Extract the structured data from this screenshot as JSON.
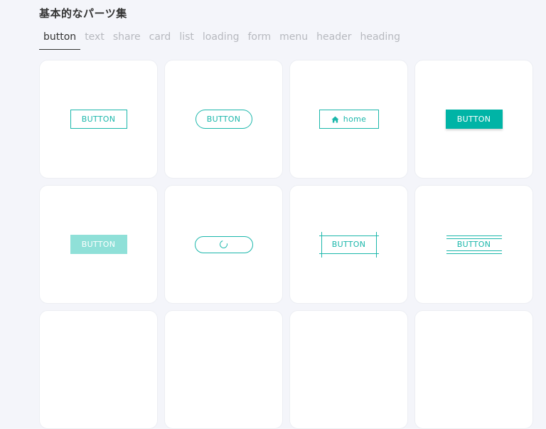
{
  "page": {
    "title": "基本的なパーツ集"
  },
  "tabs": [
    {
      "label": "button",
      "active": true
    },
    {
      "label": "text"
    },
    {
      "label": "share"
    },
    {
      "label": "card"
    },
    {
      "label": "list"
    },
    {
      "label": "loading"
    },
    {
      "label": "form"
    },
    {
      "label": "menu"
    },
    {
      "label": "header"
    },
    {
      "label": "heading"
    }
  ],
  "buttons": {
    "outline": "BUTTON",
    "pill": "BUTTON",
    "home": "home",
    "solid": "BUTTON",
    "soft": "BUTTON",
    "cross": "BUTTON",
    "lines": "BUTTON"
  },
  "icons": {
    "home": "home-icon",
    "loading": "spinner-icon"
  },
  "colors": {
    "accent": "#00b4a6",
    "accent_light": "#8fe0d8",
    "background": "#f4f5fa"
  }
}
